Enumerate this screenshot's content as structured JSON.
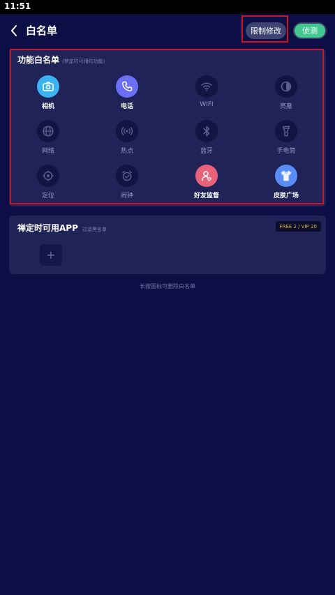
{
  "status_bar": {
    "time": "11:51"
  },
  "header": {
    "title": "白名单",
    "limit_button": "限制修改",
    "toggle_label": "侦测"
  },
  "function_whitelist": {
    "title": "功能白名单",
    "subtitle": "(禁定时可用的功能)",
    "items": [
      {
        "label": "相机",
        "icon": "camera-icon",
        "active": true,
        "color": "#3bb2f2"
      },
      {
        "label": "电话",
        "icon": "phone-icon",
        "active": true,
        "color": "#6a6ff5"
      },
      {
        "label": "WIFI",
        "icon": "wifi-icon",
        "active": false
      },
      {
        "label": "亮度",
        "icon": "brightness-icon",
        "active": false
      },
      {
        "label": "网络",
        "icon": "globe-icon",
        "active": false
      },
      {
        "label": "热点",
        "icon": "hotspot-icon",
        "active": false
      },
      {
        "label": "蓝牙",
        "icon": "bluetooth-icon",
        "active": false
      },
      {
        "label": "手电筒",
        "icon": "flashlight-icon",
        "active": false
      },
      {
        "label": "定位",
        "icon": "location-icon",
        "active": false
      },
      {
        "label": "闹钟",
        "icon": "alarm-icon",
        "active": false
      },
      {
        "label": "好友监督",
        "icon": "friend-supervise-icon",
        "active": true,
        "color": "#e8627a"
      },
      {
        "label": "皮肤广场",
        "icon": "tshirt-icon",
        "active": true,
        "color": "#5a8cf5"
      }
    ]
  },
  "app_whitelist": {
    "title": "禅定时可用APP",
    "subtitle": "过滤黑名单",
    "badge": "FREE 2 / VIP 20",
    "add_symbol": "+"
  },
  "hint": "长按图标可删除白名单"
}
